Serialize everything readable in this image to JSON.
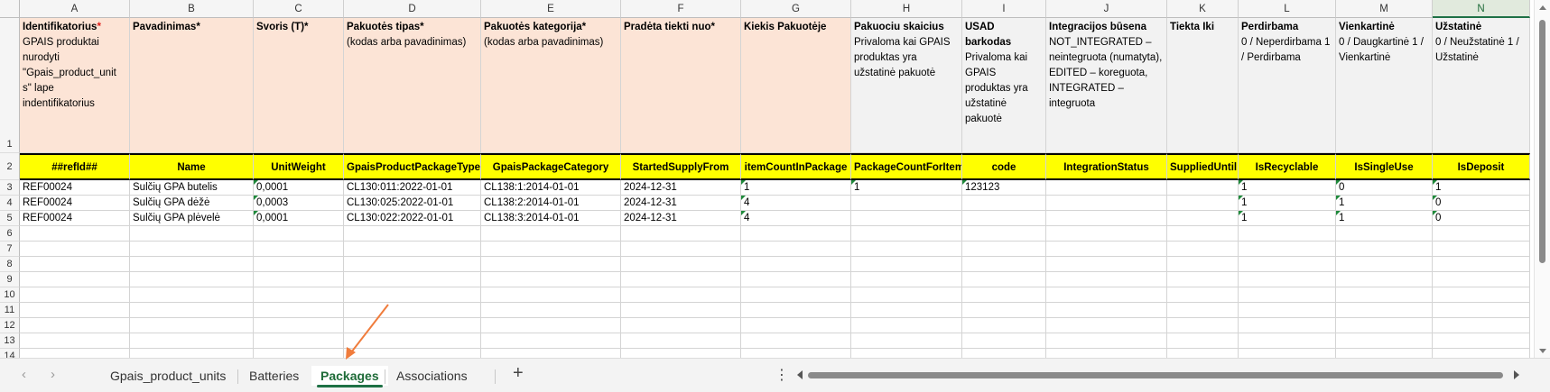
{
  "columns": [
    "A",
    "B",
    "C",
    "D",
    "E",
    "F",
    "G",
    "H",
    "I",
    "J",
    "K",
    "L",
    "M",
    "N"
  ],
  "selected_column": "N",
  "rows": [
    "1",
    "2",
    "3",
    "4",
    "5",
    "6",
    "7",
    "8",
    "9",
    "10",
    "11",
    "12",
    "13",
    "14"
  ],
  "header_row": [
    {
      "title": "Identifikatorius",
      "star": "*",
      "desc": "GPAIS produktai nurodyti \"Gpais_product_unit s\" lape indentifikatorius",
      "bg": "pink"
    },
    {
      "title": "Pavadinimas*",
      "star": "",
      "desc": "",
      "bg": "pink"
    },
    {
      "title": "Svoris (T)*",
      "star": "",
      "desc": "",
      "bg": "pink"
    },
    {
      "title": "Pakuotės tipas*",
      "star": "",
      "desc": "(kodas arba pavadinimas)",
      "bg": "pink"
    },
    {
      "title": "Pakuotės kategorija*",
      "star": "",
      "desc": "(kodas arba pavadinimas)",
      "bg": "pink"
    },
    {
      "title": "Pradėta tiekti nuo*",
      "star": "",
      "desc": "",
      "bg": "pink"
    },
    {
      "title": "Kiekis Pakuotėje",
      "star": "",
      "desc": "",
      "bg": "pink"
    },
    {
      "title": "Pakuociu skaicius",
      "star": "",
      "desc": "Privaloma kai GPAIS produktas yra užstatinė pakuotė",
      "bg": "gray"
    },
    {
      "title": "USAD barkodas",
      "star": "",
      "desc": "Privaloma kai GPAIS produktas yra užstatinė pakuotė",
      "bg": "gray"
    },
    {
      "title": "Integracijos būsena",
      "star": "",
      "desc": "NOT_INTEGRATED – neintegruota (numatyta), EDITED – koreguota, INTEGRATED – integruota",
      "bg": "gray"
    },
    {
      "title": "Tiekta Iki",
      "star": "",
      "desc": "",
      "bg": "gray"
    },
    {
      "title": "Perdirbama",
      "star": "",
      "desc": "0 / Neperdirbama 1 / Perdirbama",
      "bg": "gray"
    },
    {
      "title": "Vienkartinė",
      "star": "",
      "desc": "0 / Daugkartinė 1 / Vienkartinė",
      "bg": "gray"
    },
    {
      "title": "Užstatinė",
      "star": "",
      "desc": "0 / Neužstatinė 1 / Užstatinė",
      "bg": "gray"
    }
  ],
  "field_row": [
    "##refId##",
    "Name",
    "UnitWeight",
    "GpaisProductPackageType",
    "GpaisPackageCategory",
    "StartedSupplyFrom",
    "itemCountInPackage",
    "PackageCountForItem",
    "code",
    "IntegrationStatus",
    "SuppliedUntil",
    "IsRecyclable",
    "IsSingleUse",
    "IsDeposit"
  ],
  "data_rows": [
    [
      "REF00024",
      "Sulčių GPA butelis",
      "0,0001",
      "CL130:011:2022-01-01",
      "CL138:1:2014-01-01",
      "2024-12-31",
      "1",
      "1",
      "123123",
      "",
      "",
      "1",
      "0",
      "1"
    ],
    [
      "REF00024",
      "Sulčių GPA dėžė",
      "0,0003",
      "CL130:025:2022-01-01",
      "CL138:2:2014-01-01",
      "2024-12-31",
      "4",
      "",
      "",
      "",
      "",
      "1",
      "1",
      "0"
    ],
    [
      "REF00024",
      "Sulčių GPA plėvelė",
      "0,0001",
      "CL130:022:2022-01-01",
      "CL138:3:2014-01-01",
      "2024-12-31",
      "4",
      "",
      "",
      "",
      "",
      "1",
      "1",
      "0"
    ]
  ],
  "tabs": {
    "prev_icon": "chevron-left-icon",
    "next_icon": "chevron-right-icon",
    "items": [
      "Gpais_product_units",
      "Batteries",
      "Packages",
      "Associations"
    ],
    "active": "Packages",
    "add_label": "+",
    "menu_label": "⋮"
  },
  "colors": {
    "header_pink": "#fce4d6",
    "header_gray": "#f2f2f2",
    "field_yellow": "#ffff00",
    "accent_green": "#1e7145",
    "required_star": "#e0201c",
    "annotation_arrow": "#f07c3c"
  }
}
